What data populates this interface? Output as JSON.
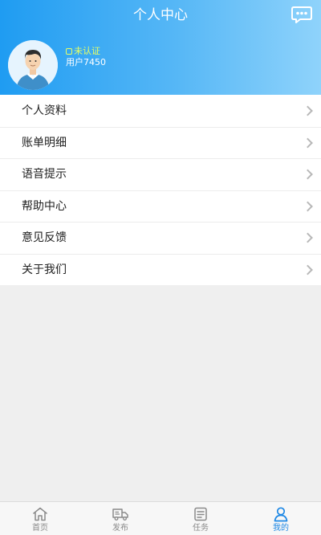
{
  "header": {
    "title": "个人中心",
    "verify_status": "未认证",
    "username": "用户7450"
  },
  "menu": {
    "items": [
      {
        "label": "个人资料"
      },
      {
        "label": "账单明细"
      },
      {
        "label": "语音提示"
      },
      {
        "label": "帮助中心"
      },
      {
        "label": "意见反馈"
      },
      {
        "label": "关于我们"
      }
    ]
  },
  "tabbar": {
    "active": "我的",
    "tabs": [
      {
        "label": "首页",
        "icon": "home-icon"
      },
      {
        "label": "发布",
        "icon": "truck-icon"
      },
      {
        "label": "任务",
        "icon": "task-list-icon"
      },
      {
        "label": "我的",
        "icon": "user-icon"
      }
    ]
  },
  "colors": {
    "header_start": "#1f9cf2",
    "header_end": "#8fd3fb",
    "verify": "#e8ff63",
    "tab_active": "#1e88e5",
    "tab_inactive": "#8a8a8a"
  }
}
